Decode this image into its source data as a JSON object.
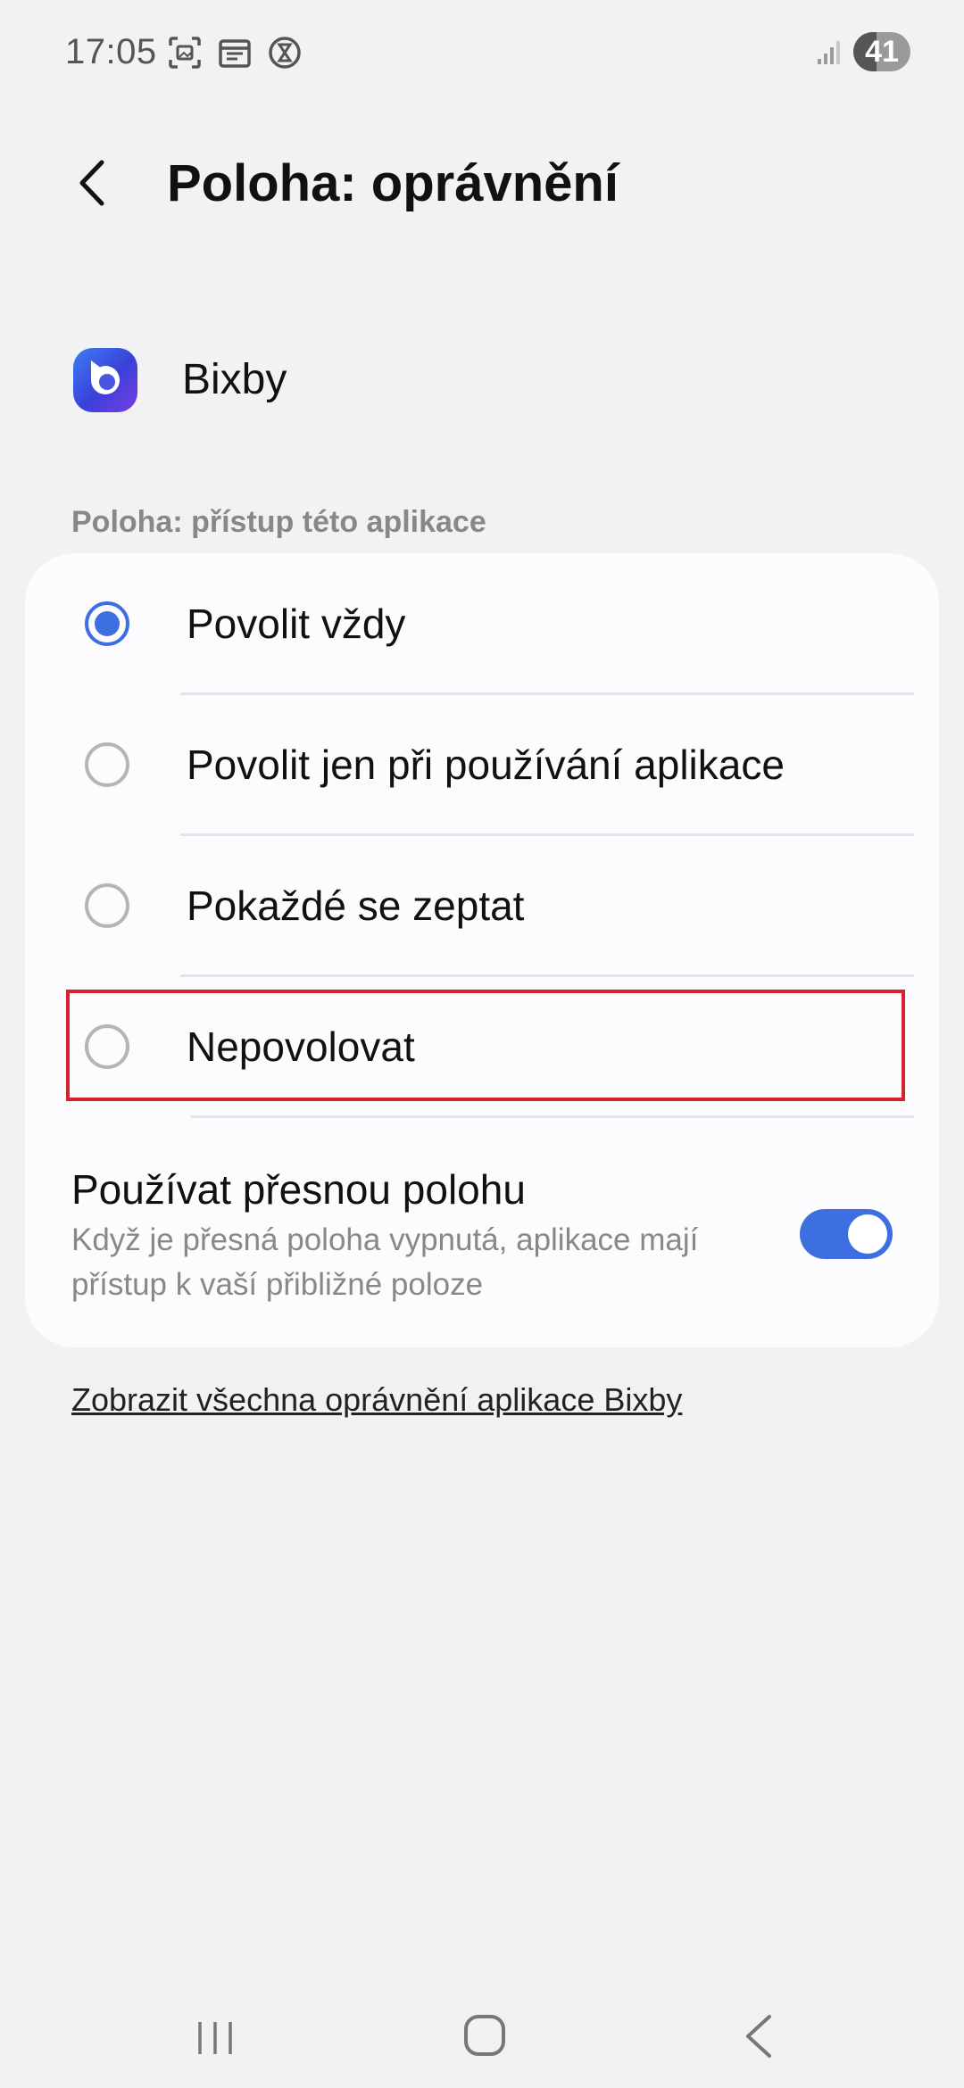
{
  "status_bar": {
    "time": "17:05",
    "battery_level": "41",
    "battery_fraction": 0.41,
    "icons": [
      "screenshot-icon",
      "calendar-icon",
      "hourglass-icon",
      "signal-icon",
      "battery-icon"
    ]
  },
  "header": {
    "title": "Poloha: oprávnění",
    "back_icon": "chevron-left-icon"
  },
  "app": {
    "name": "Bixby",
    "icon": "bixby-app-icon"
  },
  "section": {
    "label": "Poloha: přístup této aplikace"
  },
  "options": [
    {
      "label": "Povolit vždy",
      "selected": true
    },
    {
      "label": "Povolit jen při používání aplikace",
      "selected": false
    },
    {
      "label": "Pokaždé se zeptat",
      "selected": false
    },
    {
      "label": "Nepovolovat",
      "selected": false
    }
  ],
  "precise_location": {
    "title": "Používat přesnou polohu",
    "description": "Když je přesná poloha vypnutá, aplikace mají přístup k vaší přibližné poloze",
    "enabled": true
  },
  "link": {
    "label": "Zobrazit všechna oprávnění aplikace Bixby"
  },
  "colors": {
    "accent": "#3e6fe0",
    "highlight": "#d6212f",
    "background": "#f2f2f4",
    "card": "#fcfcff"
  },
  "nav": {
    "icons": [
      "recent-apps-icon",
      "home-icon",
      "back-icon"
    ]
  }
}
